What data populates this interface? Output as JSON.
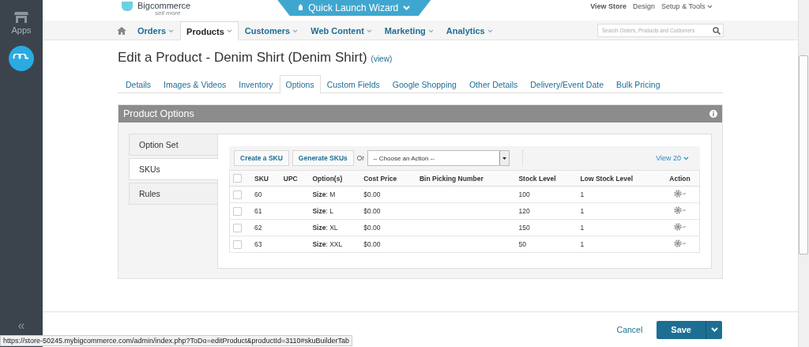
{
  "sidebar": {
    "items": [
      {
        "label": "Apps",
        "kind": "store"
      },
      {
        "kind": "app"
      }
    ],
    "collapse": "«"
  },
  "header": {
    "logo_text": "Bigcommerce",
    "logo_tagline": "sell more",
    "quick_launch": "Quick Launch Wizard",
    "links": [
      {
        "label": "View Store",
        "bold": true
      },
      {
        "label": "Design",
        "bold": false
      },
      {
        "label": "Setup & Tools",
        "bold": false
      }
    ]
  },
  "nav": {
    "items": [
      {
        "label": "Orders",
        "selected": false
      },
      {
        "label": "Products",
        "selected": true
      },
      {
        "label": "Customers",
        "selected": false
      },
      {
        "label": "Web Content",
        "selected": false
      },
      {
        "label": "Marketing",
        "selected": false
      },
      {
        "label": "Analytics",
        "selected": false
      }
    ],
    "search": {
      "placeholder": "Search Orders, Products and Customers"
    }
  },
  "page": {
    "title": "Edit a Product - Denim Shirt (Denim Shirt)",
    "view_link": "(view)"
  },
  "tabs": [
    {
      "label": "Details",
      "selected": false
    },
    {
      "label": "Images & Videos",
      "selected": false
    },
    {
      "label": "Inventory",
      "selected": false
    },
    {
      "label": "Options",
      "selected": true
    },
    {
      "label": "Custom Fields",
      "selected": false
    },
    {
      "label": "Google Shopping",
      "selected": false
    },
    {
      "label": "Other Details",
      "selected": false
    },
    {
      "label": "Delivery/Event Date",
      "selected": false
    },
    {
      "label": "Bulk Pricing",
      "selected": false
    }
  ],
  "panel": {
    "title": "Product Options",
    "side_tabs": [
      {
        "label": "Option Set",
        "selected": false
      },
      {
        "label": "SKUs",
        "selected": true
      },
      {
        "label": "Rules",
        "selected": false
      }
    ],
    "buttons": [
      "Create a SKU",
      "Generate SKUs"
    ],
    "or_label": "Or",
    "action_select": "-- Choose an Action --",
    "view_count": "View 20",
    "table": {
      "select_all_checked": false,
      "columns": [
        "SKU",
        "UPC",
        "Option(s)",
        "Cost Price",
        "Bin Picking Number",
        "Stock Level",
        "Low Stock Level",
        "Action"
      ],
      "rows": [
        {
          "checked": false,
          "sku": "60",
          "option": "**Size**: M",
          "cost": "$0.00",
          "stock": "100",
          "low": "1"
        },
        {
          "checked": false,
          "sku": "61",
          "option": "**Size**: L",
          "cost": "$0.00",
          "stock": "120",
          "low": "1"
        },
        {
          "checked": false,
          "sku": "62",
          "option": "**Size**: XL",
          "cost": "$0.00",
          "stock": "150",
          "low": "1"
        },
        {
          "checked": false,
          "sku": "63",
          "option": "**Size**: XXL",
          "cost": "$0.00",
          "stock": "50",
          "low": "1"
        }
      ]
    }
  },
  "footer": {
    "cancel": "Cancel",
    "save": "Save"
  },
  "status_url": "https://store-50245.mybigcommerce.com/admin/index.php?ToDo=editProduct&productId=3110#skuBuilderTab"
}
